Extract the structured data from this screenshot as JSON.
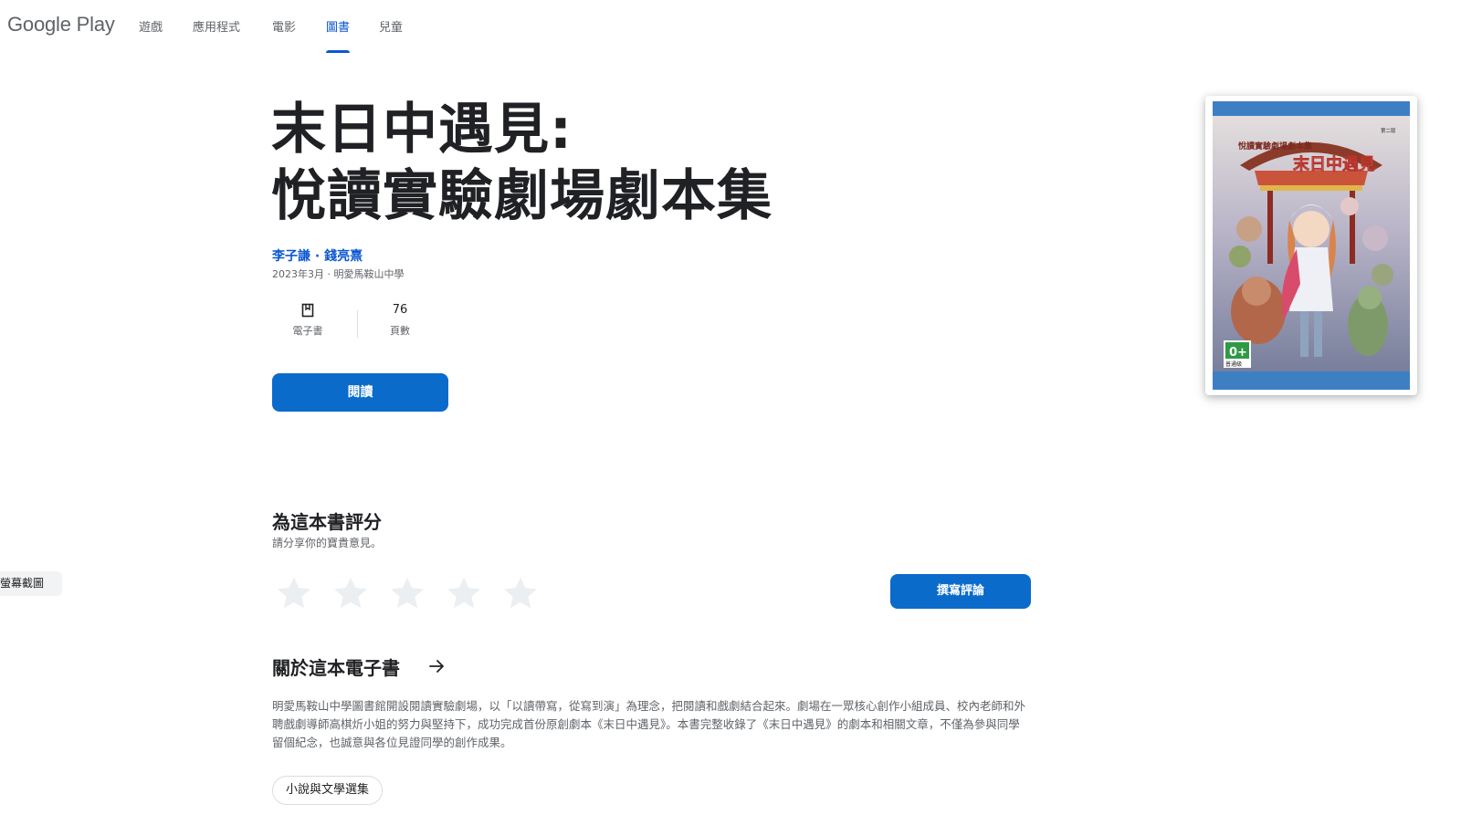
{
  "header": {
    "logo": "Google Play",
    "nav": [
      {
        "label": "遊戲"
      },
      {
        "label": "應用程式"
      },
      {
        "label": "電影"
      },
      {
        "label": "圖書",
        "active": true
      },
      {
        "label": "兒童"
      }
    ]
  },
  "book": {
    "title_line1": "末日中遇見:",
    "title_line2": "悅讀實驗劇場劇本集",
    "authors": "李子謙 · 錢亮熹",
    "meta": "2023年3月 · 明愛馬鞍山中學",
    "stats": [
      {
        "icon": "ebook-icon",
        "label": "電子書"
      },
      {
        "value": "76",
        "label": "頁數"
      }
    ],
    "read_label": "閱讀",
    "cover": {
      "series": "悅讀實驗劇場劇本集",
      "title": "末日中遇見",
      "edition": "第二版",
      "rating_badge": "0+",
      "rating_text": "普通級"
    }
  },
  "screenshots_chip": "螢幕截圖",
  "rating": {
    "title": "為這本書評分",
    "subtitle": "請分享你的寶貴意見。",
    "stars": 5,
    "write_label": "撰寫評論"
  },
  "about": {
    "title": "關於這本電子書",
    "body": "明愛馬鞍山中學圖書館開設閱讀實驗劇場，以「以讀帶寫，從寫到演」為理念，把閱讀和戲劇結合起來。劇場在一眾核心創作小組成員、校內老師和外聘戲劇導師高棋炘小姐的努力與堅持下，成功完成首份原創劇本《末日中遇見》。本書完整收錄了《末日中遇見》的劇本和相關文章，不僅為參與同學留個紀念，也誠意與各位見證同學的創作成果。",
    "genre": "小說與文學選集"
  },
  "colors": {
    "accent": "#0b57d0",
    "button": "#0b6bcb",
    "text_secondary": "#5f6368"
  }
}
